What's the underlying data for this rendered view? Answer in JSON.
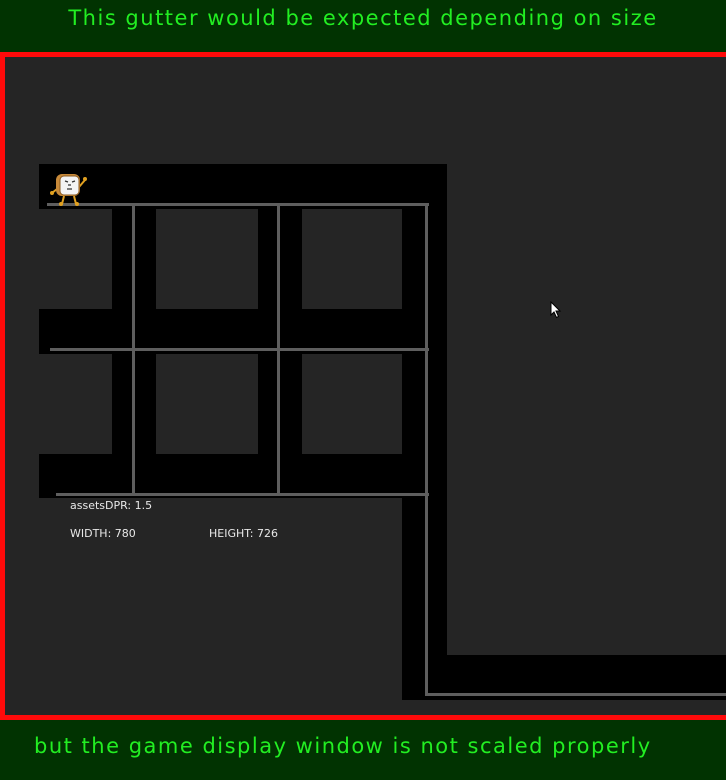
{
  "captions": {
    "top": "This gutter would be expected depending on size",
    "bottom": "but the game display window is not scaled properly"
  },
  "hud": {
    "assets_dpr_label": "assetsDPR:",
    "assets_dpr_value": "1.5",
    "width_label": "WIDTH:",
    "width_value": "780",
    "height_label": "HEIGHT:",
    "height_value": "726"
  },
  "colors": {
    "gutter": "#013301",
    "caption_text": "#22ee22",
    "frame_border": "#ff0a0a",
    "game_background": "#252525",
    "wall": "#000000",
    "pipe": "#5e5e5e"
  },
  "icons": {
    "character": "toast-character-icon",
    "cursor": "mouse-pointer-icon"
  }
}
